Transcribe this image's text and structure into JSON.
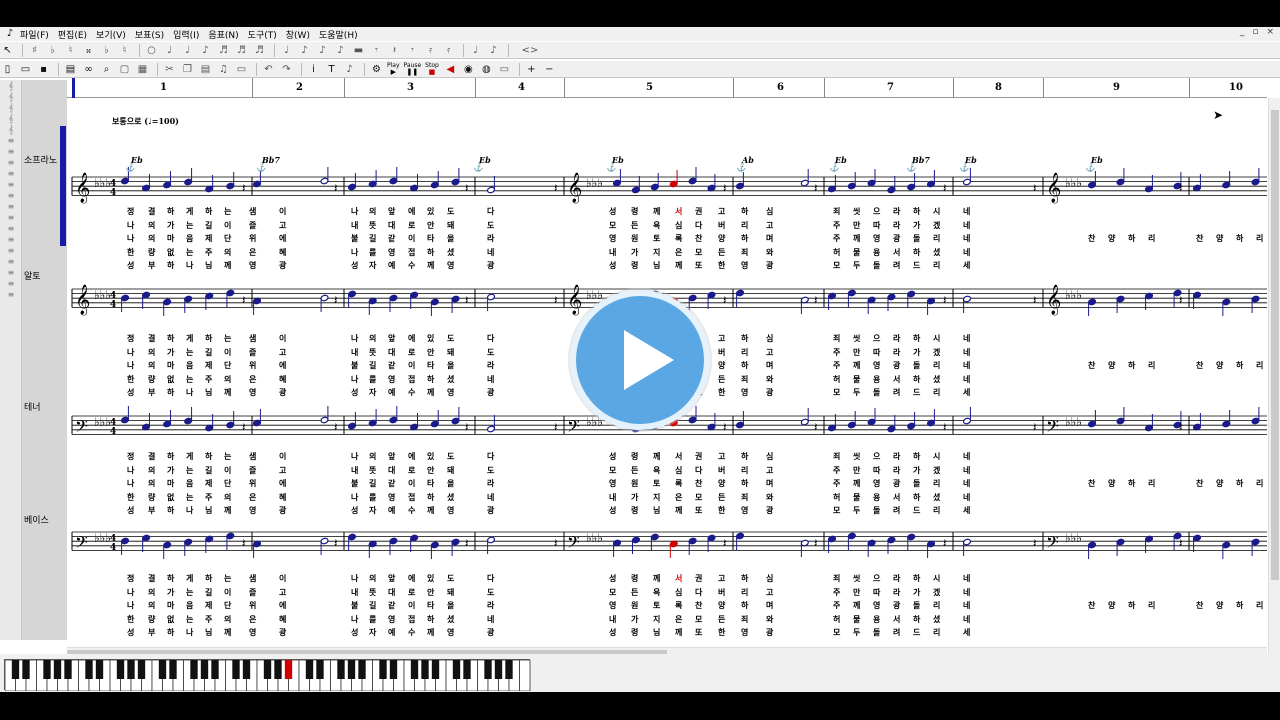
{
  "menu": {
    "items": [
      "파일(F)",
      "편집(E)",
      "보기(V)",
      "보표(S)",
      "입력(I)",
      "음표(N)",
      "도구(T)",
      "창(W)",
      "도움말(H)"
    ],
    "window_controls": [
      "_",
      "▫",
      "×"
    ]
  },
  "toolbar": {
    "play_label": "Play",
    "pause_label": "Pause",
    "stop_label": "Stop"
  },
  "ruler": {
    "measures": [
      "1",
      "2",
      "3",
      "4",
      "5",
      "6",
      "7",
      "8",
      "9",
      "10"
    ]
  },
  "tempo": "보통으로 (♩=100)",
  "chords": [
    "Eb",
    "Bb7",
    "Eb",
    "Eb",
    "Ab",
    "Eb",
    "Bb7",
    "Eb",
    "Eb"
  ],
  "tracks": [
    {
      "label": "소프라노"
    },
    {
      "label": "알토"
    },
    {
      "label": "테너"
    },
    {
      "label": "베이스"
    }
  ],
  "lyrics": {
    "verses": [
      {
        "a": [
          "정",
          "결",
          "하",
          "게",
          "하",
          "는",
          "샘",
          "이"
        ],
        "b": [
          "나",
          "의",
          "앞",
          "에",
          "있",
          "도",
          "다"
        ],
        "c": [
          "성",
          "령",
          "께",
          "서",
          "권",
          "고",
          "하",
          "심"
        ],
        "d": [
          "죄",
          "씻",
          "으",
          "라",
          "하",
          "시",
          "네"
        ],
        "e": []
      },
      {
        "a": [
          "나",
          "의",
          "가",
          "는",
          "길",
          "이",
          "즐",
          "고"
        ],
        "b": [
          "내",
          "뜻",
          "대",
          "로",
          "안",
          "돼",
          "도"
        ],
        "c": [
          "모",
          "든",
          "욕",
          "심",
          "다",
          "버",
          "리",
          "고"
        ],
        "d": [
          "주",
          "만",
          "따",
          "라",
          "가",
          "겠",
          "네"
        ],
        "e": []
      },
      {
        "a": [
          "나",
          "의",
          "마",
          "음",
          "제",
          "단",
          "위",
          "에"
        ],
        "b": [
          "불",
          "길",
          "같",
          "이",
          "타",
          "올",
          "라"
        ],
        "c": [
          "영",
          "원",
          "토",
          "록",
          "찬",
          "양",
          "하",
          "며"
        ],
        "d": [
          "주",
          "께",
          "영",
          "광",
          "돌",
          "리",
          "네"
        ],
        "e": [
          "찬",
          "양",
          "하",
          "리",
          "찬",
          "양",
          "하",
          "리"
        ]
      },
      {
        "a": [
          "한",
          "량",
          "없",
          "는",
          "주",
          "의",
          "은",
          "혜"
        ],
        "b": [
          "나",
          "를",
          "영",
          "접",
          "하",
          "셨",
          "네"
        ],
        "c": [
          "내",
          "가",
          "지",
          "은",
          "모",
          "든",
          "죄",
          "와"
        ],
        "d": [
          "허",
          "물",
          "용",
          "서",
          "하",
          "셨",
          "네"
        ],
        "e": []
      },
      {
        "a": [
          "성",
          "부",
          "하",
          "나",
          "님",
          "께",
          "영",
          "광"
        ],
        "b": [
          "성",
          "자",
          "예",
          "수",
          "께",
          "영",
          "광"
        ],
        "c": [
          "성",
          "령",
          "님",
          "께",
          "또",
          "한",
          "영",
          "광"
        ],
        "d": [
          "모",
          "두",
          "돌",
          "려",
          "드",
          "리",
          "세"
        ],
        "e": []
      }
    ]
  },
  "colors": {
    "note_blue": "#1a1a8c",
    "highlight_red": "#d00000",
    "selection_bar": "#1a1aa8",
    "play_button": "#5aa7e3"
  },
  "piano": {
    "active_key_color": "#d00000"
  }
}
